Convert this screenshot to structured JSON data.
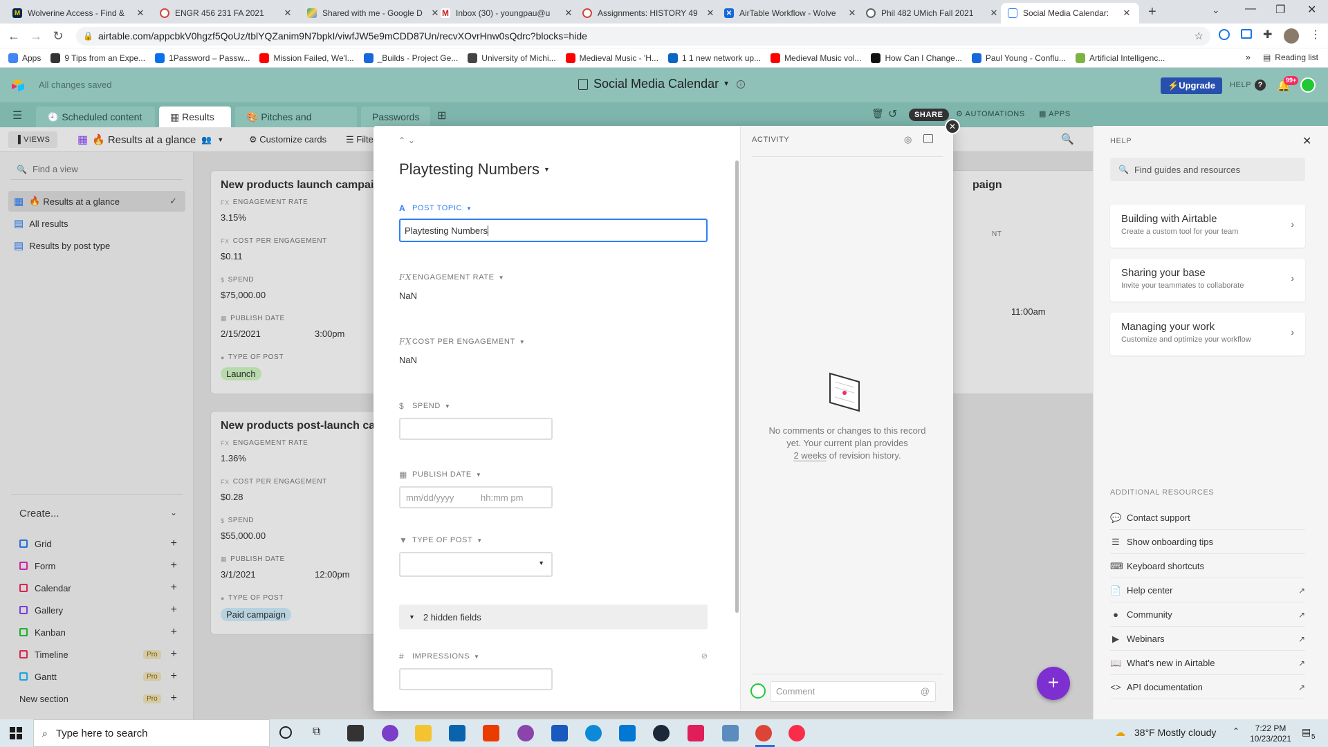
{
  "browser": {
    "tabs": [
      {
        "title": "Wolverine Access - Find &",
        "color": "#00274c"
      },
      {
        "title": "ENGR 456 231 FA 2021",
        "color": "#d14836"
      },
      {
        "title": "Shared with me - Google D",
        "color": "#1fa463"
      },
      {
        "title": "Inbox (30) - youngpau@u",
        "color": "#c5221f"
      },
      {
        "title": "Assignments: HISTORY 49",
        "color": "#d14836"
      },
      {
        "title": "AirTable Workflow - Wolve",
        "color": "#1868db"
      },
      {
        "title": "Phil 482 UMich Fall 2021",
        "color": "#5f6368"
      },
      {
        "title": "Social Media Calendar:",
        "color": "#2d7ff9"
      }
    ],
    "url": "airtable.com/appcbkV0hgzf5QoUz/tblYQZanim9N7bpkI/viwfJW5e9mCDD87Un/recvXOvrHnw0sQdrc?blocks=hide",
    "bookmarks": [
      {
        "label": "Apps",
        "color": "#4285f4"
      },
      {
        "label": "9 Tips from an Expe...",
        "color": "#333"
      },
      {
        "label": "1Password – Passw...",
        "color": "#0572ec"
      },
      {
        "label": "Mission Failed, We'l...",
        "color": "#ff0000"
      },
      {
        "label": "_Builds - Project Ge...",
        "color": "#1868db"
      },
      {
        "label": "University of Michi...",
        "color": "#444"
      },
      {
        "label": "Medieval Music - 'H...",
        "color": "#ff0000"
      },
      {
        "label": "1 1 new network up...",
        "color": "#0a66c2"
      },
      {
        "label": "Medieval Music vol...",
        "color": "#ff0000"
      },
      {
        "label": "How Can I Change...",
        "color": "#111"
      },
      {
        "label": "Paul Young - Conflu...",
        "color": "#1868db"
      },
      {
        "label": "Artificial Intelligenc...",
        "color": "#7cb342"
      }
    ],
    "reading_list": "Reading list"
  },
  "header": {
    "saved": "All changes saved",
    "base_title": "Social Media Calendar",
    "upgrade": "Upgrade",
    "help": "HELP",
    "notif_count": "99+"
  },
  "table_tabs": [
    "Scheduled content",
    "Results",
    "Pitches and requests",
    "Passwords"
  ],
  "toolbar": {
    "share": "SHARE",
    "automations": "AUTOMATIONS",
    "apps": "APPS"
  },
  "viewbar": {
    "views": "VIEWS",
    "current_view": "Results at a glance",
    "customize": "Customize cards",
    "filter": "Filte"
  },
  "sidebar": {
    "find_placeholder": "Find a view",
    "views": [
      "Results at a glance",
      "All results",
      "Results by post type"
    ],
    "create": "Create...",
    "create_items": [
      {
        "label": "Grid",
        "color": "#2d7ff9",
        "pro": ""
      },
      {
        "label": "Form",
        "color": "#e929ba",
        "pro": ""
      },
      {
        "label": "Calendar",
        "color": "#f82b60",
        "pro": ""
      },
      {
        "label": "Gallery",
        "color": "#8b46ff",
        "pro": ""
      },
      {
        "label": "Kanban",
        "color": "#20c933",
        "pro": ""
      },
      {
        "label": "Timeline",
        "color": "#f82b60",
        "pro": "Pro"
      },
      {
        "label": "Gantt",
        "color": "#18bfff",
        "pro": "Pro"
      }
    ],
    "new_section": "New section",
    "new_section_pro": "Pro"
  },
  "cards": [
    {
      "title": "New products launch campaig",
      "engagement_label": "ENGAGEMENT RATE",
      "engagement": "3.15%",
      "cpe_label": "COST PER ENGAGEMENT",
      "cpe": "$0.11",
      "spend_label": "SPEND",
      "spend": "$75,000.00",
      "date_label": "PUBLISH DATE",
      "date": "2/15/2021",
      "time": "3:00pm",
      "type_label": "TYPE OF POST",
      "type": "Launch",
      "type_color": "#d1f7c4"
    },
    {
      "title": "New products post-launch can",
      "engagement_label": "ENGAGEMENT RATE",
      "engagement": "1.36%",
      "cpe_label": "COST PER ENGAGEMENT",
      "cpe": "$0.28",
      "spend_label": "SPEND",
      "spend": "$55,000.00",
      "date_label": "PUBLISH DATE",
      "date": "3/1/2021",
      "time": "12:00pm",
      "type_label": "TYPE OF POST",
      "type": "Paid campaign",
      "type_color": "#d0f0fd"
    }
  ],
  "right_card": {
    "title": "paign",
    "label": "NT",
    "time": "11:00am"
  },
  "record": {
    "title": "Playtesting Numbers",
    "fields": {
      "post_topic_label": "POST TOPIC",
      "post_topic_value": "Playtesting Numbers",
      "engagement_label": "ENGAGEMENT RATE",
      "engagement_value": "NaN",
      "cpe_label": "COST PER ENGAGEMENT",
      "cpe_value": "NaN",
      "spend_label": "SPEND",
      "date_label": "PUBLISH DATE",
      "date_placeholder": "mm/dd/yyyy",
      "time_placeholder": "hh:mm pm",
      "type_label": "TYPE OF POST",
      "hidden_fields": "2 hidden fields",
      "impressions_label": "IMPRESSIONS"
    },
    "activity": {
      "title": "ACTIVITY",
      "empty_1": "No comments or changes to this record",
      "empty_2": "yet. Your current plan provides",
      "empty_3a": "2 weeks",
      "empty_3b": " of revision history.",
      "comment_placeholder": "Comment"
    }
  },
  "help": {
    "title": "HELP",
    "search_placeholder": "Find guides and resources",
    "cards": [
      {
        "title": "Building with Airtable",
        "subtitle": "Create a custom tool for your team"
      },
      {
        "title": "Sharing your base",
        "subtitle": "Invite your teammates to collaborate"
      },
      {
        "title": "Managing your work",
        "subtitle": "Customize and optimize your workflow"
      }
    ],
    "resources_title": "ADDITIONAL RESOURCES",
    "resources": [
      {
        "label": "Contact support",
        "external": false
      },
      {
        "label": "Show onboarding tips",
        "external": false
      },
      {
        "label": "Keyboard shortcuts",
        "external": false
      },
      {
        "label": "Help center",
        "external": true
      },
      {
        "label": "Community",
        "external": true
      },
      {
        "label": "Webinars",
        "external": true
      },
      {
        "label": "What's new in Airtable",
        "external": true
      },
      {
        "label": "API documentation",
        "external": true
      }
    ]
  },
  "taskbar": {
    "search_placeholder": "Type here to search",
    "weather": "38°F  Mostly cloudy",
    "time": "7:22 PM",
    "date": "10/23/2021",
    "notif": "5"
  }
}
